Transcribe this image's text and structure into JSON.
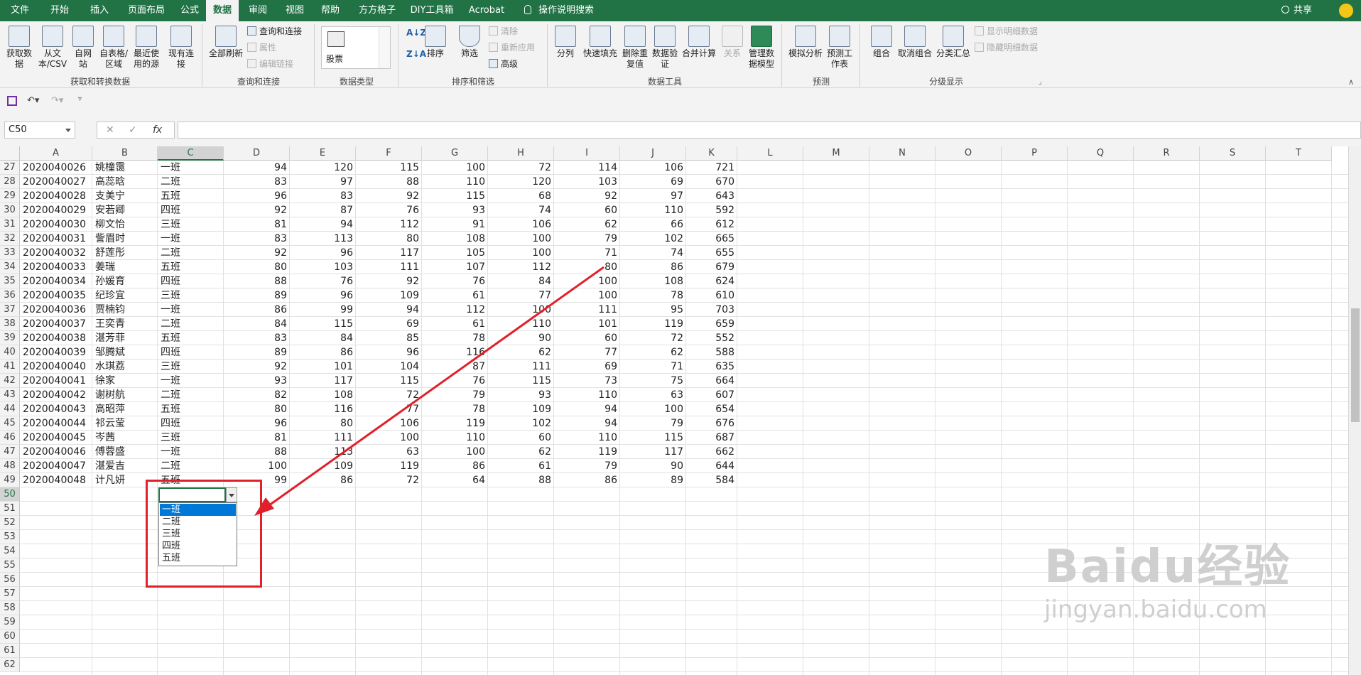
{
  "tabs": [
    "文件",
    "开始",
    "插入",
    "页面布局",
    "公式",
    "数据",
    "审阅",
    "视图",
    "帮助",
    "方方格子",
    "DIY工具箱",
    "Acrobat",
    "操作说明搜索"
  ],
  "share_label": "共享",
  "ribbon": {
    "buttons": {
      "get_data": "获取数据",
      "from_text": "从文本/CSV",
      "from_web": "自网站",
      "from_table": "自表格/区域",
      "recent_sources": "最近使用的源",
      "existing_conn": "现有连接",
      "refresh_all": "全部刷新",
      "queries_conn": "查询和连接",
      "properties": "属性",
      "edit_links": "编辑链接",
      "stocks": "股票",
      "sort": "排序",
      "filter": "筛选",
      "clear": "清除",
      "reapply": "重新应用",
      "advanced": "高级",
      "text_to_cols": "分列",
      "flash_fill": "快速填充",
      "remove_dup": "删除重复值",
      "data_validation": "数据验证",
      "consolidate": "合并计算",
      "relationships": "关系",
      "data_model": "管理数据模型",
      "what_if": "模拟分析",
      "forecast_sheet": "预测工作表",
      "group": "组合",
      "ungroup": "取消组合",
      "subtotal": "分类汇总",
      "show_detail": "显示明细数据",
      "hide_detail": "隐藏明细数据"
    },
    "groups": [
      "获取和转换数据",
      "查询和连接",
      "数据类型",
      "排序和筛选",
      "数据工具",
      "预测",
      "分级显示"
    ]
  },
  "name_box": "C50",
  "fx_symbol": "fx",
  "columns": [
    "A",
    "B",
    "C",
    "D",
    "E",
    "F",
    "G",
    "H",
    "I",
    "J",
    "K",
    "L",
    "M",
    "N",
    "O",
    "P",
    "Q",
    "R",
    "S",
    "T"
  ],
  "row_numbers": [
    "27",
    "28",
    "29",
    "30",
    "31",
    "32",
    "33",
    "34",
    "35",
    "36",
    "37",
    "38",
    "39",
    "40",
    "41",
    "42",
    "43",
    "44",
    "45",
    "46",
    "47",
    "48",
    "49",
    "50",
    "51",
    "52",
    "53",
    "54",
    "55",
    "56",
    "57",
    "58",
    "59",
    "60",
    "61",
    "62"
  ],
  "rows": [
    [
      "2020040026",
      "姚橦霭",
      "一班",
      "94",
      "120",
      "115",
      "100",
      "72",
      "114",
      "106",
      "721"
    ],
    [
      "2020040027",
      "高蕊晗",
      "二班",
      "83",
      "97",
      "88",
      "110",
      "120",
      "103",
      "69",
      "670"
    ],
    [
      "2020040028",
      "支美宁",
      "五班",
      "96",
      "83",
      "92",
      "115",
      "68",
      "92",
      "97",
      "643"
    ],
    [
      "2020040029",
      "安若卿",
      "四班",
      "92",
      "87",
      "76",
      "93",
      "74",
      "60",
      "110",
      "592"
    ],
    [
      "2020040030",
      "柳文怡",
      "三班",
      "81",
      "94",
      "112",
      "91",
      "106",
      "62",
      "66",
      "612"
    ],
    [
      "2020040031",
      "訾眉时",
      "一班",
      "83",
      "113",
      "80",
      "108",
      "100",
      "79",
      "102",
      "665"
    ],
    [
      "2020040032",
      "舒莲彤",
      "二班",
      "92",
      "96",
      "117",
      "105",
      "100",
      "71",
      "74",
      "655"
    ],
    [
      "2020040033",
      "姜瑞",
      "五班",
      "80",
      "103",
      "111",
      "107",
      "112",
      "80",
      "86",
      "679"
    ],
    [
      "2020040034",
      "孙媛育",
      "四班",
      "88",
      "76",
      "92",
      "76",
      "84",
      "100",
      "108",
      "624"
    ],
    [
      "2020040035",
      "纪珍宜",
      "三班",
      "89",
      "96",
      "109",
      "61",
      "77",
      "100",
      "78",
      "610"
    ],
    [
      "2020040036",
      "贾楠钧",
      "一班",
      "86",
      "99",
      "94",
      "112",
      "100",
      "111",
      "95",
      "703"
    ],
    [
      "2020040037",
      "王奕青",
      "二班",
      "84",
      "115",
      "69",
      "61",
      "110",
      "101",
      "119",
      "659"
    ],
    [
      "2020040038",
      "湛芳菲",
      "五班",
      "83",
      "84",
      "85",
      "78",
      "90",
      "60",
      "72",
      "552"
    ],
    [
      "2020040039",
      "邹腾斌",
      "四班",
      "89",
      "86",
      "96",
      "116",
      "62",
      "77",
      "62",
      "588"
    ],
    [
      "2020040040",
      "水琪荔",
      "三班",
      "92",
      "101",
      "104",
      "87",
      "111",
      "69",
      "71",
      "635"
    ],
    [
      "2020040041",
      "徐家",
      "一班",
      "93",
      "117",
      "115",
      "76",
      "115",
      "73",
      "75",
      "664"
    ],
    [
      "2020040042",
      "谢树航",
      "二班",
      "82",
      "108",
      "72",
      "79",
      "93",
      "110",
      "63",
      "607"
    ],
    [
      "2020040043",
      "高昭萍",
      "五班",
      "80",
      "116",
      "77",
      "78",
      "109",
      "94",
      "100",
      "654"
    ],
    [
      "2020040044",
      "祁云莹",
      "四班",
      "96",
      "80",
      "106",
      "119",
      "102",
      "94",
      "79",
      "676"
    ],
    [
      "2020040045",
      "岑茜",
      "三班",
      "81",
      "111",
      "100",
      "110",
      "60",
      "110",
      "115",
      "687"
    ],
    [
      "2020040046",
      "傅蓉盛",
      "一班",
      "88",
      "113",
      "63",
      "100",
      "62",
      "119",
      "117",
      "662"
    ],
    [
      "2020040047",
      "湛爱吉",
      "二班",
      "100",
      "109",
      "119",
      "86",
      "61",
      "79",
      "90",
      "644"
    ],
    [
      "2020040048",
      "计凡妍",
      "五班",
      "99",
      "86",
      "72",
      "64",
      "88",
      "86",
      "89",
      "584"
    ]
  ],
  "dropdown_options": [
    "一班",
    "二班",
    "三班",
    "四班",
    "五班"
  ],
  "watermark": {
    "line1": "Baidu经验",
    "line2": "jingyan.baidu.com"
  },
  "colors": {
    "excel_green": "#217346",
    "highlight_blue": "#0078d7",
    "annotation_red": "#e0202a"
  }
}
